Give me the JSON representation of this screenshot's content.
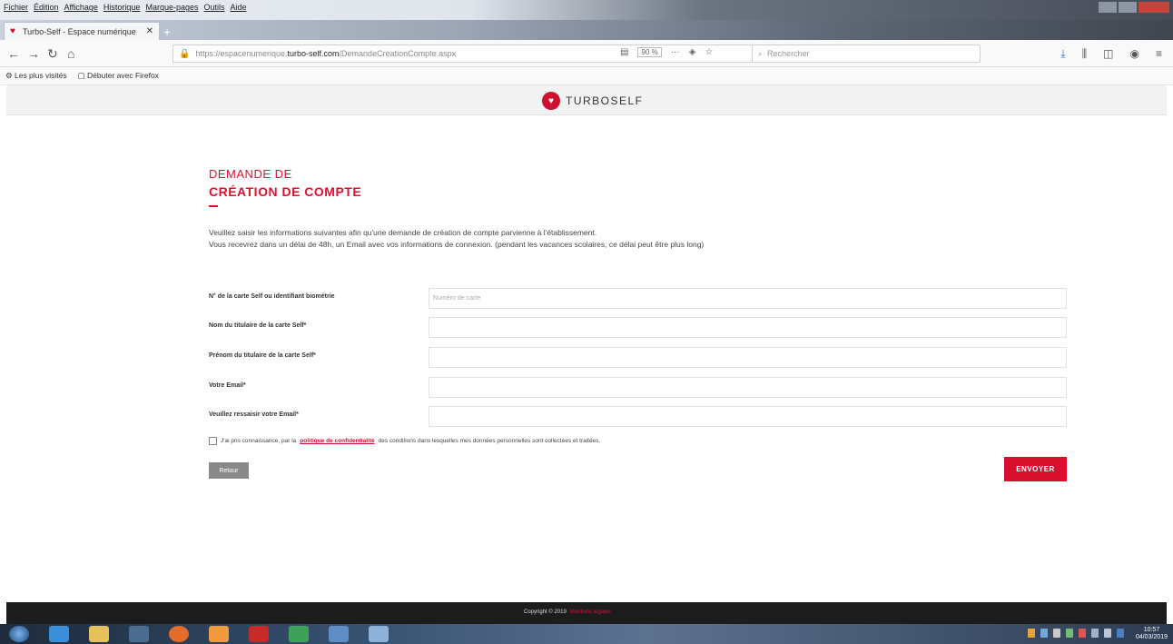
{
  "browser": {
    "menu_items": [
      "Fichier",
      "Édition",
      "Affichage",
      "Historique",
      "Marque-pages",
      "Outils",
      "Aide"
    ],
    "tab_title": "Turbo-Self - Espace numérique",
    "url_prefix": "https://espacenumerique.",
    "url_domain": "turbo-self.com",
    "url_path": "/DemandeCreationCompte.aspx",
    "zoom": "90 %",
    "search_placeholder": "Rechercher",
    "bookmarks": [
      "Les plus visités",
      "Débuter avec Firefox"
    ]
  },
  "site": {
    "logo_text": "TURBOSELF",
    "title_line1": "DEMANDE DE",
    "title_line2": "CRÉATION DE COMPTE",
    "intro_line1": "Veuillez saisir les informations suivantes afin qu'une demande de création de compte parvienne à l'établissement.",
    "intro_line2": "Vous recevrez dans un délai de 48h, un Email avec vos informations de connexion. (pendant les vacances scolaires, ce délai peut être plus long)"
  },
  "form": {
    "fields": [
      {
        "label": "N° de la carte Self ou identifiant biométrie",
        "placeholder": "Numéro de carte"
      },
      {
        "label": "Nom du titulaire de la carte Self*",
        "placeholder": ""
      },
      {
        "label": "Prénom du titulaire de la carte Self*",
        "placeholder": ""
      },
      {
        "label": "Votre Email*",
        "placeholder": ""
      },
      {
        "label": "Veuillez ressaisir votre Email*",
        "placeholder": ""
      }
    ],
    "consent_before": "J'ai pris connaissance, par la",
    "consent_link": "politique de confidentialité",
    "consent_after": "des conditions dans lesquelles mes données personnelles sont collectées et traitées.",
    "consent_checked": false,
    "back_label": "Retour",
    "submit_label": "ENVOYER"
  },
  "footer": {
    "copyright": "Copyright © 2019",
    "link": "Mentions légales"
  },
  "taskbar": {
    "time": "10:57",
    "date": "04/03/2019"
  },
  "colors": {
    "brand": "#d8102e",
    "footer": "#1c1c1c"
  }
}
